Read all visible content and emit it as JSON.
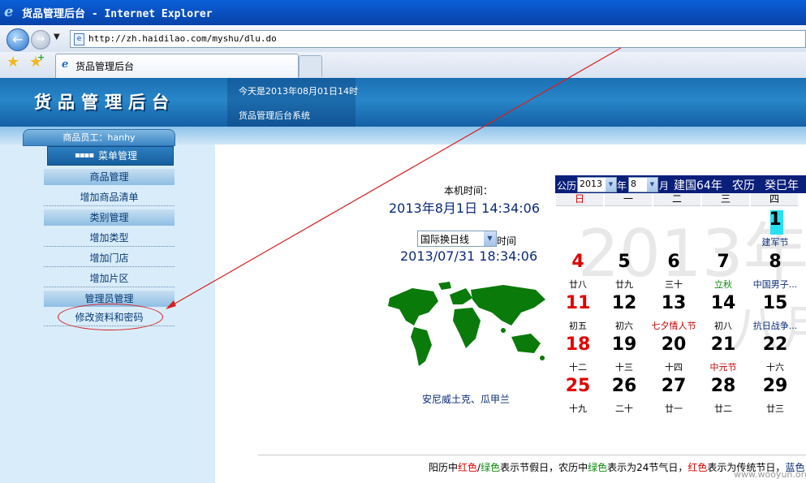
{
  "window": {
    "title": "货品管理后台 - Internet Explorer",
    "url": "http://zh.haidilao.com/myshu/dlu.do",
    "tab_label": "货品管理后台"
  },
  "header": {
    "logo": "货品管理后台",
    "today": "今天是2013年08月01日14时",
    "system": "货品管理后台系统"
  },
  "sidebar": {
    "user": "商品员工：hanhy",
    "menu_button": "菜单管理",
    "entries": [
      {
        "type": "cat",
        "label": "商品管理"
      },
      {
        "type": "item",
        "label": "增加商品清单"
      },
      {
        "type": "cat",
        "label": "类别管理"
      },
      {
        "type": "item",
        "label": "增加类型"
      },
      {
        "type": "item",
        "label": "增加门店"
      },
      {
        "type": "item",
        "label": "增加片区"
      },
      {
        "type": "cat",
        "label": "管理员管理"
      },
      {
        "type": "item",
        "label": "修改资料和密码"
      }
    ]
  },
  "clock": {
    "local_label": "本机时间：",
    "local_datetime": "2013年8月1日 14:34:06",
    "tz_select": "国际换日线",
    "time_label": "时间",
    "tz_datetime": "2013/07/31 18:34:06",
    "tz_city": "安尼威土克、瓜甲兰"
  },
  "calendar": {
    "solar_label": "公历",
    "year": "2013",
    "year_label": "年",
    "month": "8",
    "month_label": "月",
    "roc": "建国64年",
    "lunar_label": "农历",
    "ganzhi": "癸巳年",
    "weekdays": [
      "日",
      "一",
      "二",
      "三",
      "四"
    ],
    "watermark_year": "2013年",
    "watermark_month": "八月",
    "days": [
      {
        "d": "1",
        "sub": "建军节",
        "col": 4,
        "row": 0,
        "color": "#000000",
        "subcolor": "#0a2a78"
      },
      {
        "d": "4",
        "sub": "廿八",
        "col": 0,
        "row": 1,
        "color": "#e00000",
        "subcolor": "#000000"
      },
      {
        "d": "5",
        "sub": "廿九",
        "col": 1,
        "row": 1,
        "color": "#000000",
        "subcolor": "#000000"
      },
      {
        "d": "6",
        "sub": "三十",
        "col": 2,
        "row": 1,
        "color": "#000000",
        "subcolor": "#000000"
      },
      {
        "d": "7",
        "sub": "立秋",
        "col": 3,
        "row": 1,
        "color": "#000000",
        "subcolor": "#0a8a0a"
      },
      {
        "d": "8",
        "sub": "中国男子...",
        "col": 4,
        "row": 1,
        "color": "#000000",
        "subcolor": "#0a2a78"
      },
      {
        "d": "11",
        "sub": "初五",
        "col": 0,
        "row": 2,
        "color": "#e00000",
        "subcolor": "#000000"
      },
      {
        "d": "12",
        "sub": "初六",
        "col": 1,
        "row": 2,
        "color": "#000000",
        "subcolor": "#000000"
      },
      {
        "d": "13",
        "sub": "七夕情人节",
        "col": 2,
        "row": 2,
        "color": "#000000",
        "subcolor": "#c00000"
      },
      {
        "d": "14",
        "sub": "初八",
        "col": 3,
        "row": 2,
        "color": "#000000",
        "subcolor": "#000000"
      },
      {
        "d": "15",
        "sub": "抗日战争...",
        "col": 4,
        "row": 2,
        "color": "#000000",
        "subcolor": "#0a2a78"
      },
      {
        "d": "18",
        "sub": "十二",
        "col": 0,
        "row": 3,
        "color": "#e00000",
        "subcolor": "#000000"
      },
      {
        "d": "19",
        "sub": "十三",
        "col": 1,
        "row": 3,
        "color": "#000000",
        "subcolor": "#000000"
      },
      {
        "d": "20",
        "sub": "十四",
        "col": 2,
        "row": 3,
        "color": "#000000",
        "subcolor": "#000000"
      },
      {
        "d": "21",
        "sub": "中元节",
        "col": 3,
        "row": 3,
        "color": "#000000",
        "subcolor": "#c00000"
      },
      {
        "d": "22",
        "sub": "十六",
        "col": 4,
        "row": 3,
        "color": "#000000",
        "subcolor": "#000000"
      },
      {
        "d": "25",
        "sub": "十九",
        "col": 0,
        "row": 4,
        "color": "#e00000",
        "subcolor": "#000000"
      },
      {
        "d": "26",
        "sub": "二十",
        "col": 1,
        "row": 4,
        "color": "#000000",
        "subcolor": "#000000"
      },
      {
        "d": "27",
        "sub": "廿一",
        "col": 2,
        "row": 4,
        "color": "#000000",
        "subcolor": "#000000"
      },
      {
        "d": "28",
        "sub": "廿二",
        "col": 3,
        "row": 4,
        "color": "#000000",
        "subcolor": "#000000"
      },
      {
        "d": "29",
        "sub": "廿三",
        "col": 4,
        "row": 4,
        "color": "#000000",
        "subcolor": "#000000"
      }
    ]
  },
  "legend": {
    "p1": "阳历中",
    "red": "红色",
    "slash": "/",
    "green": "绿色",
    "p2": "表示节假日，农历中",
    "green2": "绿色",
    "p3": "表示为24节气日，",
    "red2": "红色",
    "p4": "表示为传统节日，",
    "blue": "蓝色",
    "c_red": "#e00000",
    "c_green": "#0a8a0a",
    "c_blue": "#0a2a78"
  },
  "watermark_site": "www.wooyun.org"
}
